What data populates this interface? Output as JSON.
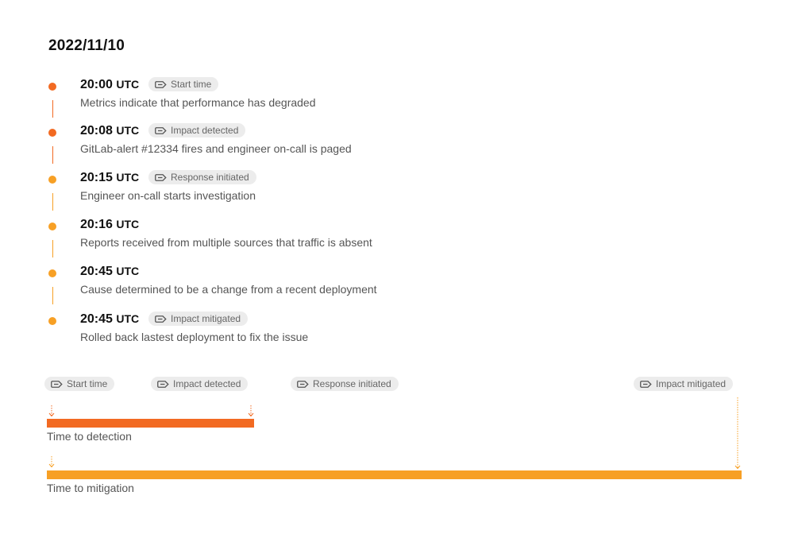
{
  "date": "2022/11/10",
  "colors": {
    "detection": "#f26a22",
    "mitigation": "#f7a025",
    "tag_bg": "#ececec",
    "tag_text": "#666666"
  },
  "events": [
    {
      "time": "20:00",
      "tz": "UTC",
      "tag": "Start time",
      "description": "Metrics indicate that performance has degraded",
      "color": "#f26a22"
    },
    {
      "time": "20:08",
      "tz": "UTC",
      "tag": "Impact detected",
      "description": "GitLab-alert #12334 fires and engineer on-call is paged",
      "color": "#f26a22"
    },
    {
      "time": "20:15",
      "tz": "UTC",
      "tag": "Response initiated",
      "description": "Engineer on-call starts investigation",
      "color": "#f7a025"
    },
    {
      "time": "20:16",
      "tz": "UTC",
      "tag": null,
      "description": "Reports received from multiple sources that traffic is absent",
      "color": "#f7a025"
    },
    {
      "time": "20:45",
      "tz": "UTC",
      "tag": null,
      "description": "Cause determined to be a change from a recent deployment",
      "color": "#f7a025"
    },
    {
      "time": "20:45",
      "tz": "UTC",
      "tag": "Impact mitigated",
      "description": "Rolled back lastest deployment to fix the issue",
      "color": "#f7a025"
    }
  ],
  "summary": {
    "tags": {
      "start": "Start time",
      "detected": "Impact detected",
      "response": "Response initiated",
      "mitigated": "Impact mitigated"
    },
    "bars": [
      {
        "label": "Time to detection",
        "from": "20:00",
        "to": "20:08"
      },
      {
        "label": "Time to mitigation",
        "from": "20:00",
        "to": "20:45"
      }
    ]
  },
  "icons": {
    "tag": "tag-icon",
    "marker": "dotted-arrow-down-icon"
  }
}
